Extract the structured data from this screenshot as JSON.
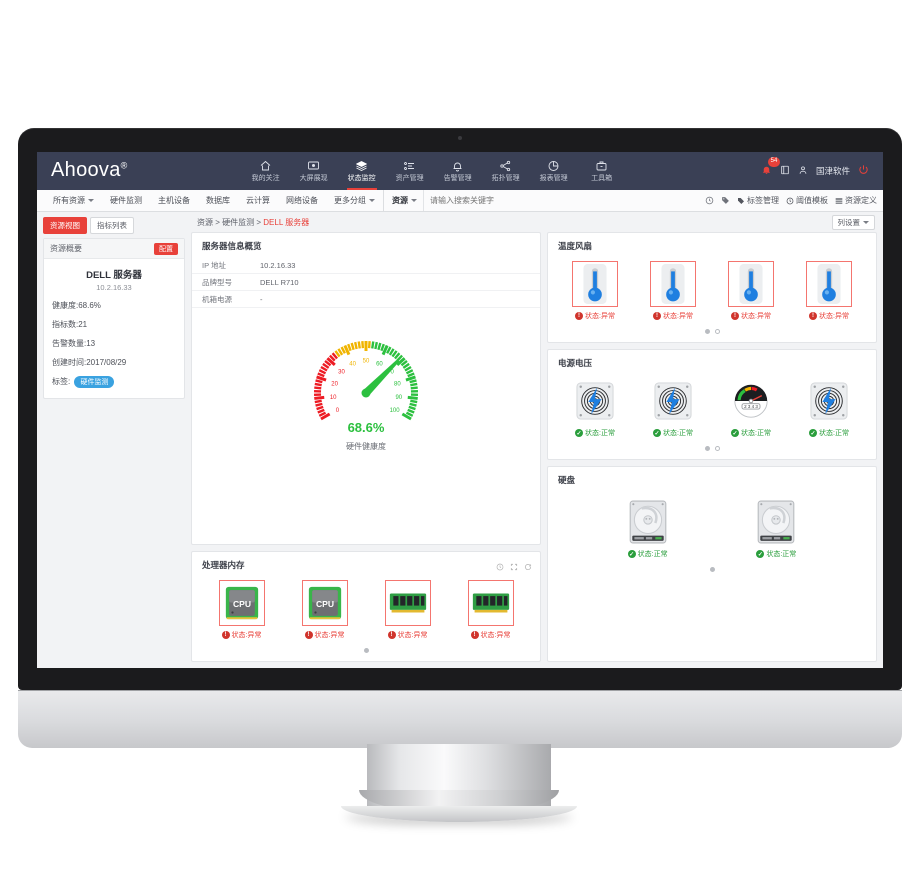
{
  "app": {
    "logo": "Ahoova",
    "logo_sup": "®",
    "brand_accent": "#e8413a",
    "topbar_bg": "#3a4055"
  },
  "topnav": {
    "items": [
      {
        "label": "我的关注",
        "icon": "home-icon",
        "active": false
      },
      {
        "label": "大屏展现",
        "icon": "screen-icon",
        "active": false
      },
      {
        "label": "状态监控",
        "icon": "layers-icon",
        "active": true
      },
      {
        "label": "资产管理",
        "icon": "list-icon",
        "active": false
      },
      {
        "label": "告警管理",
        "icon": "bell-icon",
        "active": false
      },
      {
        "label": "拓扑管理",
        "icon": "topology-icon",
        "active": false
      },
      {
        "label": "报表管理",
        "icon": "pie-icon",
        "active": false
      },
      {
        "label": "工具箱",
        "icon": "toolbox-icon",
        "active": false
      }
    ],
    "alert_count": "54",
    "user_name": "国津软件"
  },
  "subnav": {
    "items": [
      {
        "label": "所有资源",
        "caret": true
      },
      {
        "label": "硬件监测",
        "caret": false
      },
      {
        "label": "主机设备",
        "caret": false
      },
      {
        "label": "数据库",
        "caret": false
      },
      {
        "label": "云计算",
        "caret": false
      },
      {
        "label": "网络设备",
        "caret": false
      },
      {
        "label": "更多分组",
        "caret": true
      }
    ],
    "scope_label": "资源",
    "search_placeholder": "请输入搜索关键字",
    "tools": [
      {
        "label": "标签管理",
        "icon": "tag-icon"
      },
      {
        "label": "阈值模板",
        "icon": "clock-icon"
      },
      {
        "label": "资源定义",
        "icon": "grid-icon"
      }
    ]
  },
  "sidebar": {
    "tabs": [
      {
        "label": "资源视图",
        "active": true
      },
      {
        "label": "指标列表",
        "active": false
      }
    ],
    "card_title": "资源概要",
    "config_label": "配置",
    "resource_name": "DELL 服务器",
    "resource_ip": "10.2.16.33",
    "fields": [
      "健康度:68.6%",
      "指标数:21",
      "告警数量:13",
      "创建时间:2017/08/29"
    ],
    "tag_label": "标签:",
    "tag_value": "硬件监测"
  },
  "breadcrumb": {
    "root": "资源",
    "mid": "硬件监测",
    "current": "DELL 服务器",
    "separator": ">",
    "column_settings": "列设置"
  },
  "panels": {
    "server_info": {
      "title": "服务器信息概览",
      "rows": [
        {
          "key": "IP 地址",
          "value": "10.2.16.33"
        },
        {
          "key": "品牌型号",
          "value": "DELL R710"
        },
        {
          "key": "机箱电源",
          "value": "-"
        }
      ]
    },
    "gauge": {
      "value_text": "68.6%",
      "value": 68.6,
      "caption": "硬件健康度",
      "ticks": [
        "0",
        "10",
        "20",
        "30",
        "40",
        "50",
        "60",
        "70",
        "80",
        "90",
        "100"
      ],
      "min": 0,
      "max": 100,
      "color_red": "#ed1c24",
      "color_yellow": "#f0b400",
      "color_green": "#2cc03f",
      "value_color": "#2cc03f"
    },
    "cpu_memory": {
      "title": "处理器内存",
      "tools": [
        "clock-icon",
        "expand-icon",
        "refresh-icon"
      ],
      "devices": [
        {
          "icon": "cpu-icon",
          "status": "状态:异常",
          "state": "alarm"
        },
        {
          "icon": "cpu-icon",
          "status": "状态:异常",
          "state": "alarm"
        },
        {
          "icon": "memory-icon",
          "status": "状态:异常",
          "state": "alarm"
        },
        {
          "icon": "memory-icon",
          "status": "状态:异常",
          "state": "alarm"
        }
      ],
      "pages": 1,
      "active_page": 0
    },
    "temp_fan": {
      "title": "温度风扇",
      "devices": [
        {
          "icon": "thermometer-icon",
          "status": "状态:异常",
          "state": "alarm"
        },
        {
          "icon": "thermometer-icon",
          "status": "状态:异常",
          "state": "alarm"
        },
        {
          "icon": "thermometer-icon",
          "status": "状态:异常",
          "state": "alarm"
        },
        {
          "icon": "thermometer-icon",
          "status": "状态:异常",
          "state": "alarm"
        }
      ],
      "pages": 2,
      "active_page": 0
    },
    "power_voltage": {
      "title": "电源电压",
      "devices": [
        {
          "icon": "power-supply-icon",
          "status": "状态:正常",
          "state": "ok"
        },
        {
          "icon": "power-supply-icon",
          "status": "状态:正常",
          "state": "ok"
        },
        {
          "icon": "voltage-meter-icon",
          "status": "状态:正常",
          "state": "ok"
        },
        {
          "icon": "power-supply-icon",
          "status": "状态:正常",
          "state": "ok"
        }
      ],
      "pages": 2,
      "active_page": 0
    },
    "disk": {
      "title": "硬盘",
      "devices": [
        {
          "icon": "hdd-icon",
          "status": "状态:正常",
          "state": "ok"
        },
        {
          "icon": "hdd-icon",
          "status": "状态:正常",
          "state": "ok"
        }
      ],
      "pages": 1,
      "active_page": 0
    }
  }
}
